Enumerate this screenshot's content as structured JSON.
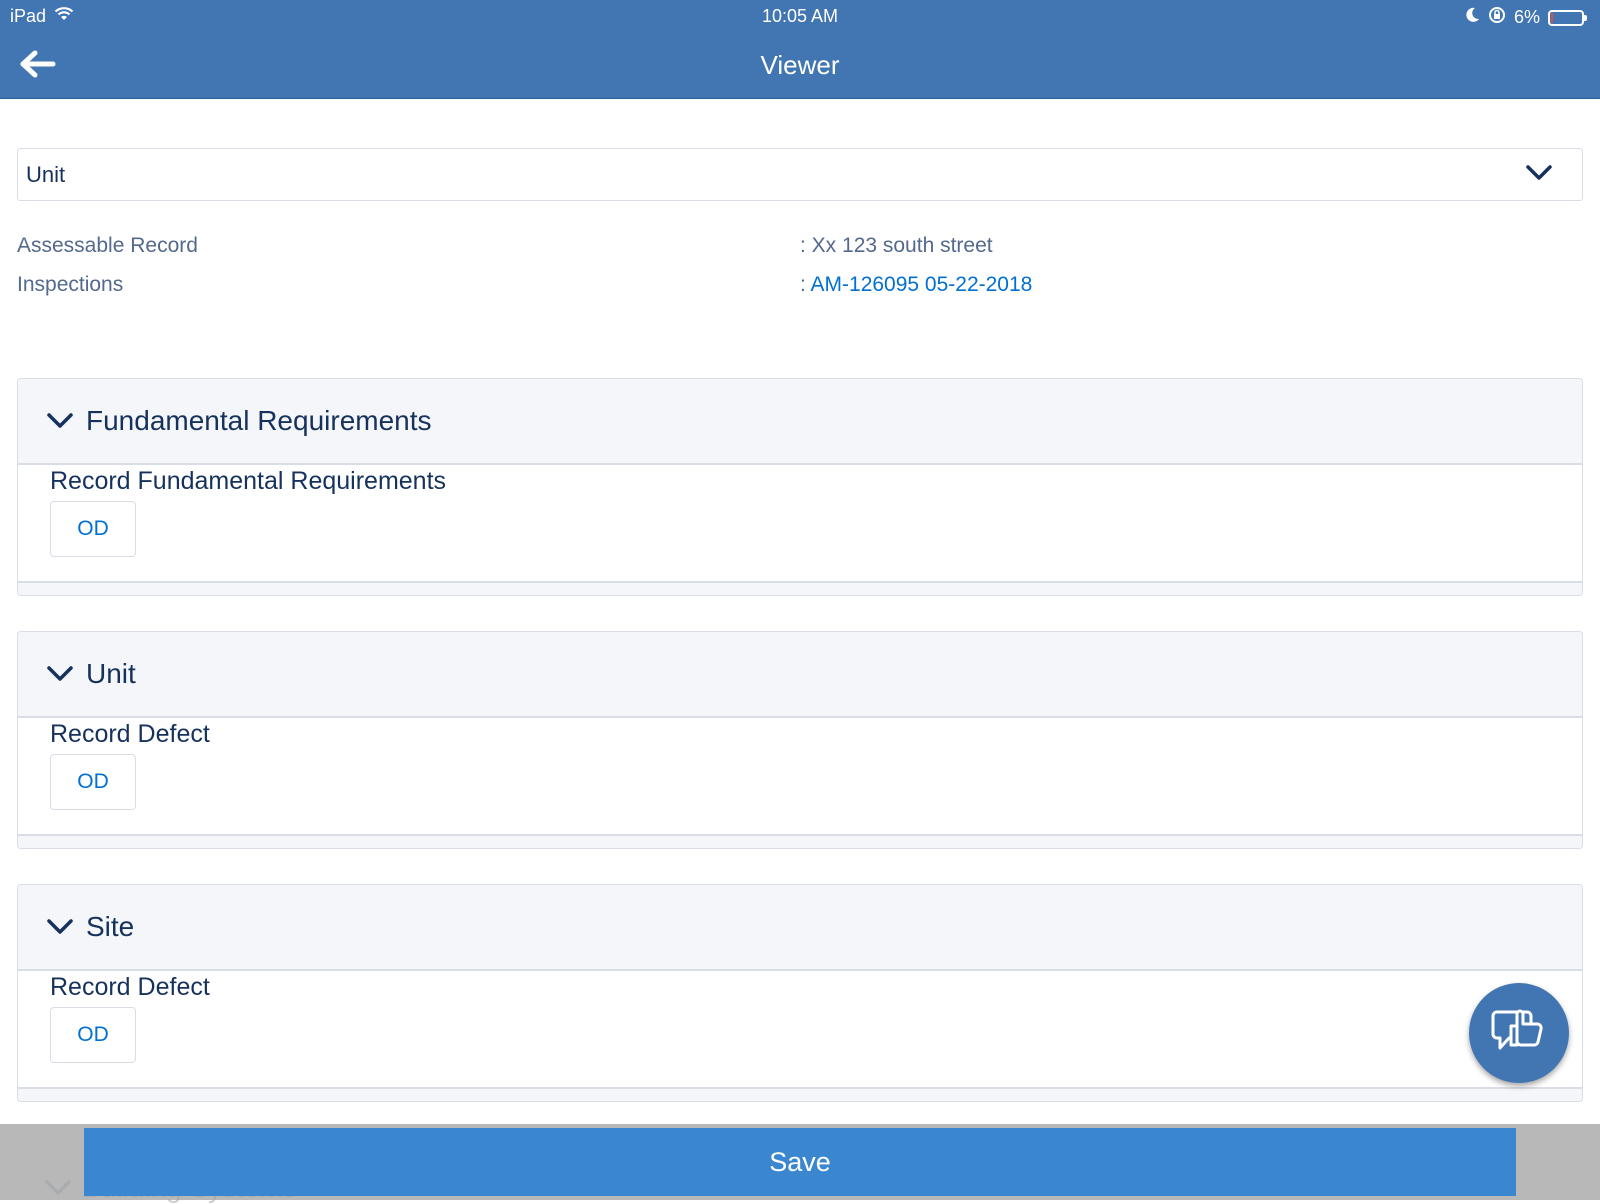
{
  "status_bar": {
    "device": "iPad",
    "time": "10:05 AM",
    "battery": "6%",
    "battery_level": 0.06,
    "battery_color": "#e24c4c"
  },
  "header": {
    "title": "Viewer"
  },
  "selector": {
    "value": "Unit"
  },
  "info": {
    "assessable_label": "Assessable Record",
    "assessable_value": ": Xx 123 south street",
    "inspections_label": "Inspections",
    "inspections_prefix": ": ",
    "inspections_link": "AM-126095 05-22-2018"
  },
  "sections": [
    {
      "title": "Fundamental Requirements",
      "record_label": "Record Fundamental Requirements",
      "button": "OD"
    },
    {
      "title": "Unit",
      "record_label": "Record Defect",
      "button": "OD"
    },
    {
      "title": "Site",
      "record_label": "Record Defect",
      "button": "OD"
    }
  ],
  "footer": {
    "save_label": "Save",
    "hidden_section_title": "Building Systems"
  },
  "colors": {
    "header_bg": "#4276b2",
    "link": "#0070d2",
    "save_bg": "#3a87cf"
  }
}
